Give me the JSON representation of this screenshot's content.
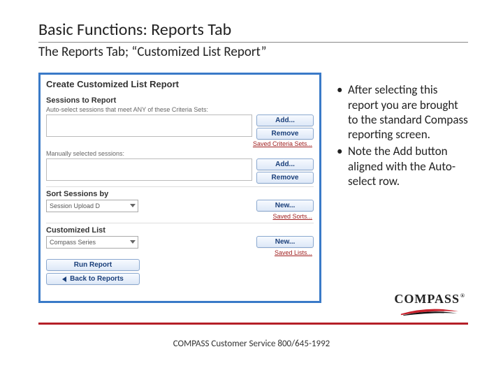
{
  "title": "Basic Functions: Reports Tab",
  "subtitle": "The Reports Tab; “Customized List Report”",
  "screenshot": {
    "heading": "Create Customized List Report",
    "sessions_heading": "Sessions to Report",
    "auto_label": "Auto-select sessions that meet ANY of these Criteria Sets:",
    "manual_label": "Manually selected sessions:",
    "btn_add": "Add...",
    "btn_remove": "Remove",
    "link_saved_sets": "Saved Criteria Sets...",
    "sort_heading": "Sort Sessions by",
    "sort_value": "Session Upload D",
    "btn_new": "New...",
    "link_saved_sorts": "Saved Sorts...",
    "list_heading": "Customized List",
    "list_value": "Compass Series",
    "link_saved_lists": "Saved Lists...",
    "btn_run": "Run Report",
    "btn_back": "Back to Reports"
  },
  "bullets": [
    "After selecting this report you are brought to the standard Compass reporting screen.",
    "Note the Add button aligned with the Auto-select row."
  ],
  "logo": {
    "text": "COMPASS",
    "registered": "®"
  },
  "footer": "COMPASS Customer Service 800/645-1992"
}
